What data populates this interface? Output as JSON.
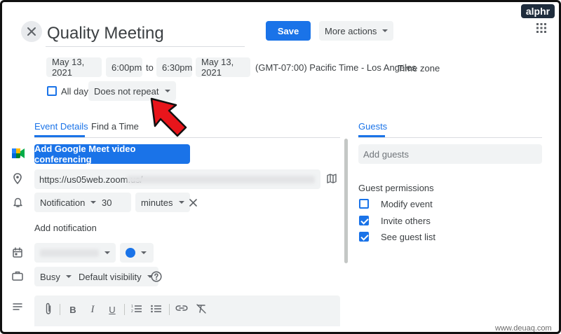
{
  "brand": {
    "logo_text": "alphr",
    "watermark": "www.deuaq.com"
  },
  "header": {
    "title": "Quality Meeting",
    "save_label": "Save",
    "more_actions_label": "More actions"
  },
  "datetime": {
    "start_date": "May 13, 2021",
    "start_time": "6:00pm",
    "to_label": "to",
    "end_time": "6:30pm",
    "end_date": "May 13, 2021",
    "timezone": "(GMT-07:00) Pacific Time - Los Angeles",
    "timezone_link": "Time zone",
    "all_day_label": "All day",
    "all_day_checked": false,
    "repeat_label": "Does not repeat"
  },
  "tabs": [
    {
      "label": "Event Details",
      "active": true
    },
    {
      "label": "Find a Time",
      "active": false
    }
  ],
  "details": {
    "meet_button_label": "Add Google Meet video conferencing",
    "location_value": "https://us05web.zoom.us/",
    "notification_type": "Notification",
    "notification_amount": "30",
    "notification_unit": "minutes",
    "add_notification_label": "Add notification",
    "calendar_color": "#1a73e8",
    "busy_label": "Busy",
    "visibility_label": "Default visibility"
  },
  "guests": {
    "tab_label": "Guests",
    "add_placeholder": "Add guests",
    "permissions_title": "Guest permissions",
    "permissions": [
      {
        "label": "Modify event",
        "checked": false
      },
      {
        "label": "Invite others",
        "checked": true
      },
      {
        "label": "See guest list",
        "checked": true
      }
    ]
  },
  "colors": {
    "accent": "#1a73e8",
    "arrow": "#e8151b",
    "chip_bg": "#f1f3f4"
  },
  "icons": {
    "close": "close-icon",
    "apps": "apps-grid-icon",
    "meet": "google-meet-icon",
    "location": "location-pin-icon",
    "map": "map-icon",
    "notification": "bell-icon",
    "calendar": "calendar-icon",
    "status": "briefcase-icon",
    "help": "help-icon",
    "description": "description-lines-icon",
    "attach": "paperclip-icon",
    "bold": "bold-icon",
    "italic": "italic-icon",
    "underline": "underline-icon",
    "ordered_list": "numbered-list-icon",
    "bullet_list": "bulleted-list-icon",
    "link": "link-icon",
    "clear_format": "clear-formatting-icon"
  }
}
